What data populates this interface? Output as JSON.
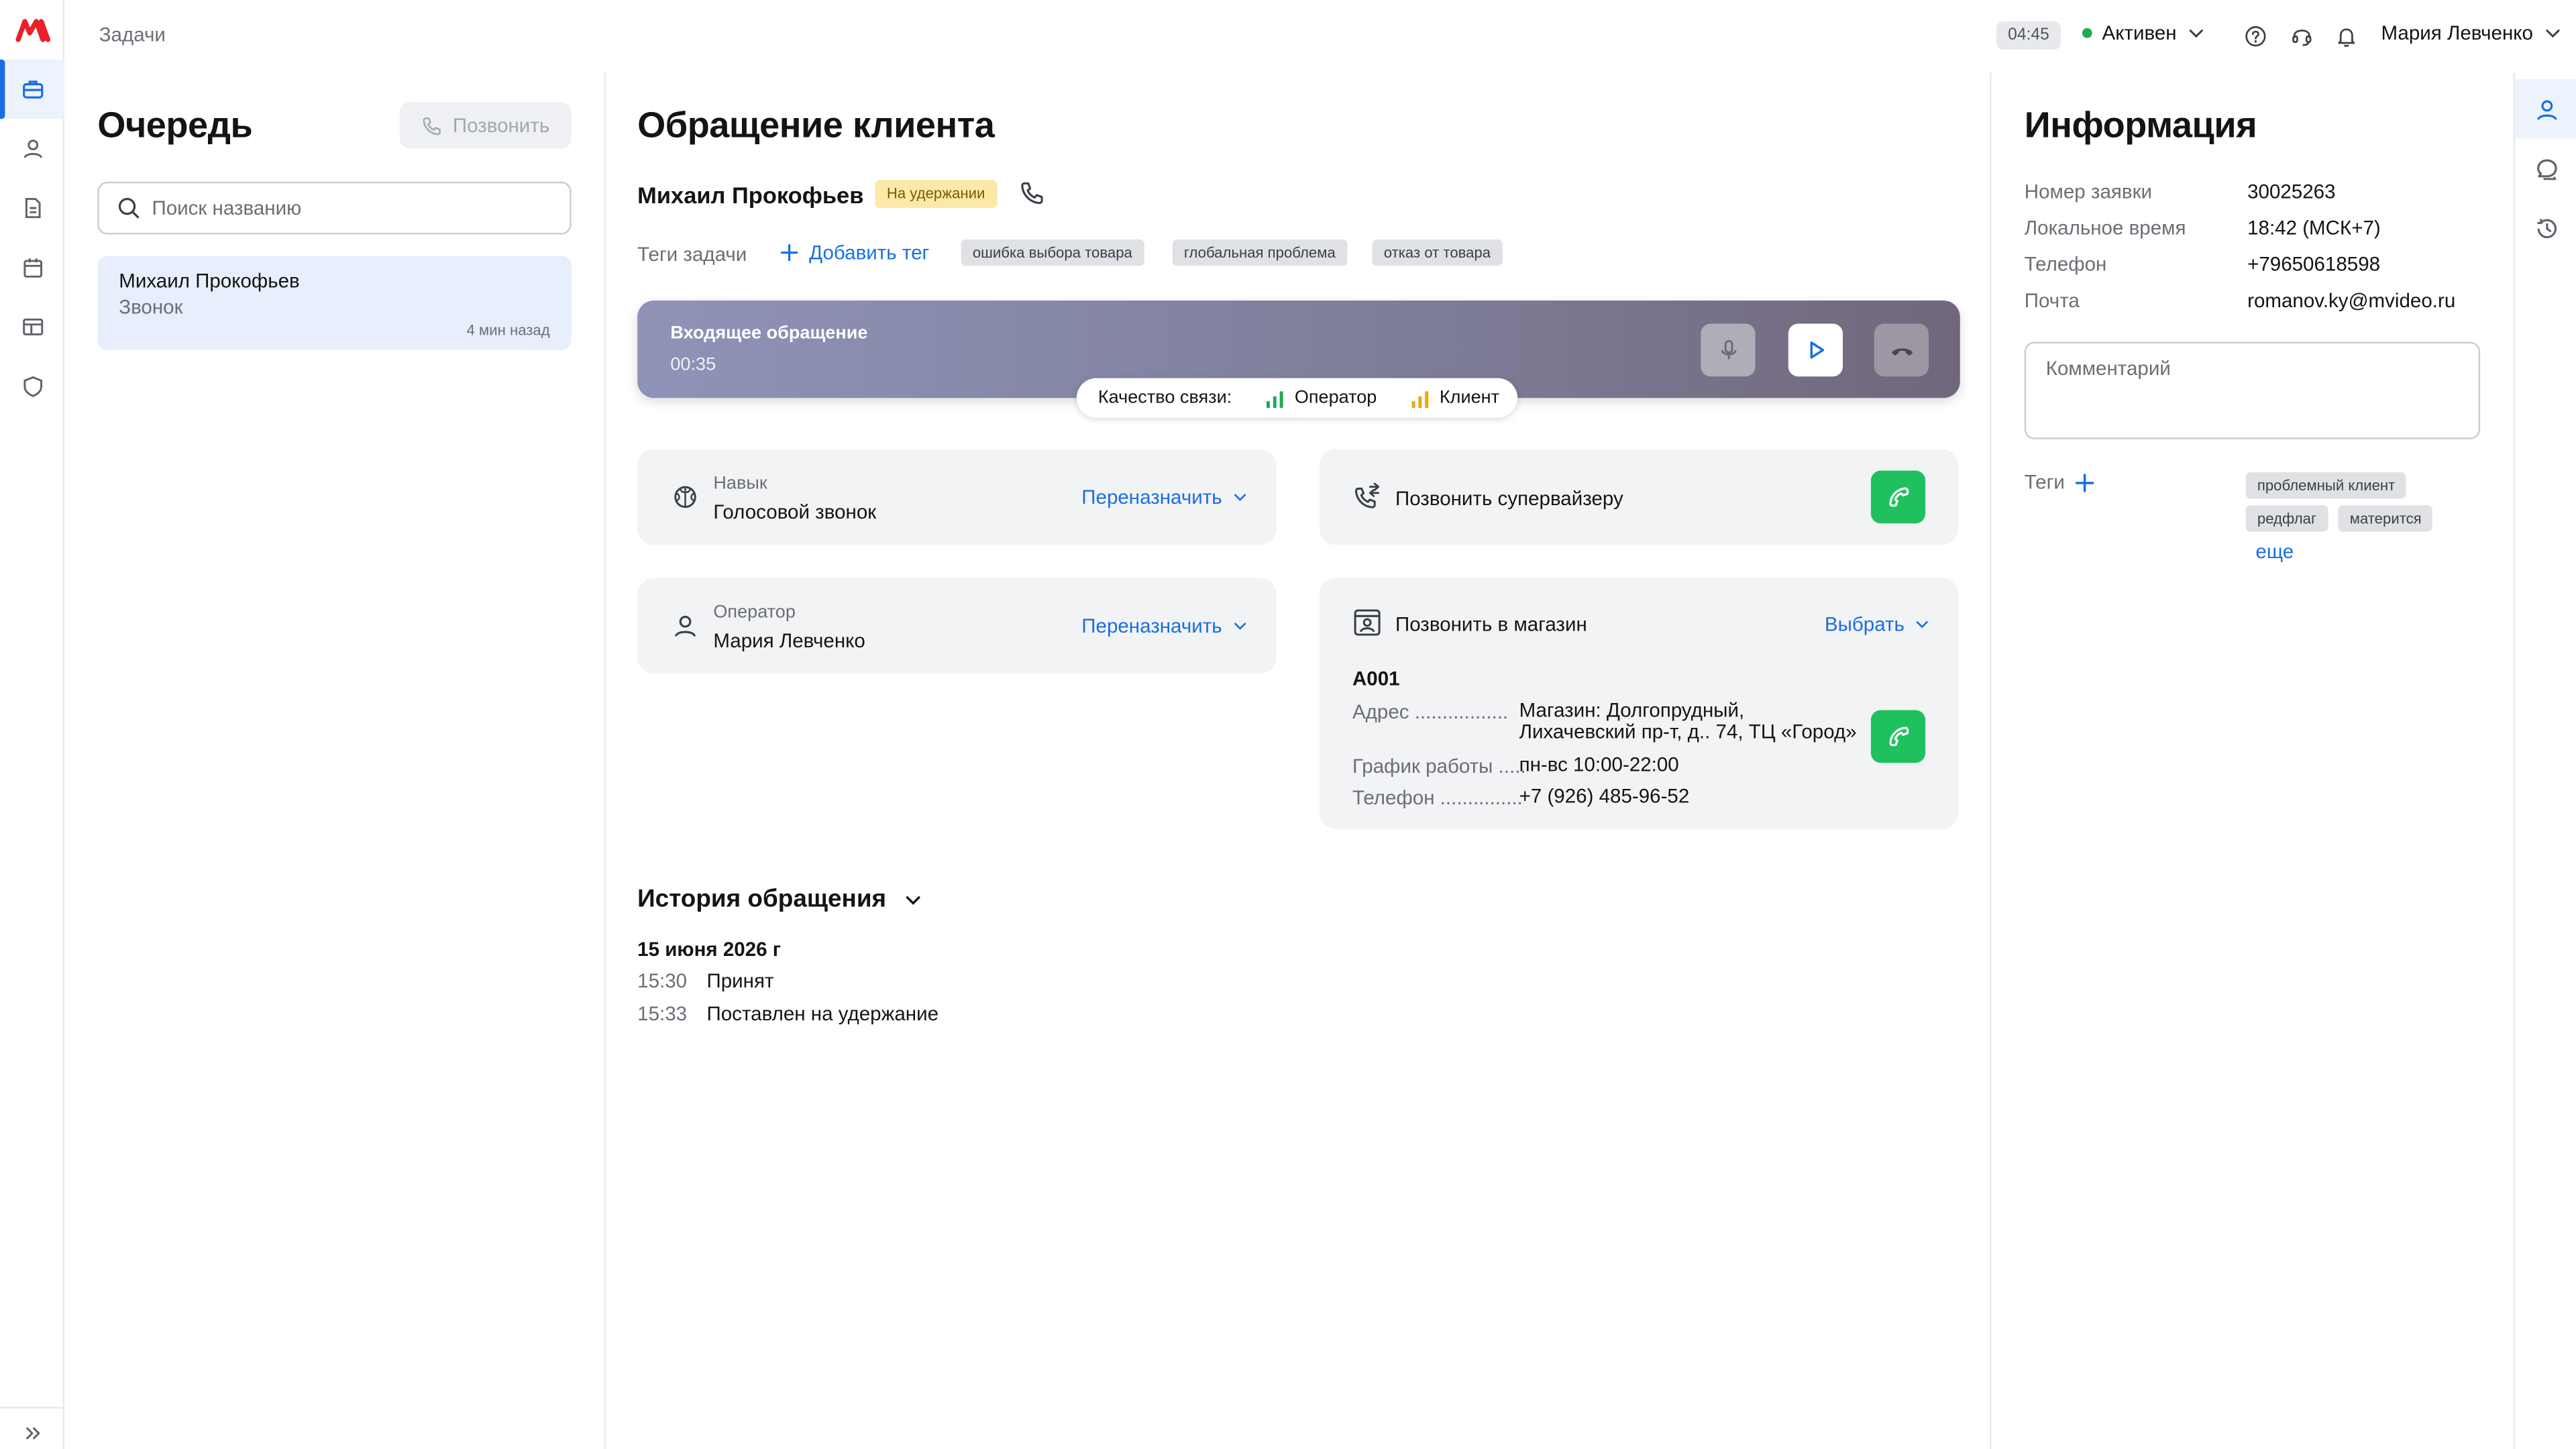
{
  "brand": {
    "logo_text": "M",
    "accent": "#1a6fe0",
    "logo_color": "#e8212b"
  },
  "sidebar": {
    "items": [
      {
        "icon": "briefcase-icon",
        "active": true
      },
      {
        "icon": "user-icon",
        "active": false
      },
      {
        "icon": "document-icon",
        "active": false
      },
      {
        "icon": "calendar-icon",
        "active": false
      },
      {
        "icon": "table-icon",
        "active": false
      },
      {
        "icon": "shield-icon",
        "active": false
      }
    ],
    "expand_icon": "chevrons-right-icon"
  },
  "topbar": {
    "breadcrumb": "Задачи",
    "timer": "04:45",
    "status": "Активен",
    "status_color": "#1faa55",
    "icons": [
      "help-icon",
      "headset-icon",
      "bell-icon"
    ],
    "user_name": "Мария Левченко"
  },
  "queue": {
    "title": "Очередь",
    "call_button": "Позвонить",
    "search_placeholder": "Поиск названию",
    "items": [
      {
        "name": "Михаил Прокофьев",
        "type": "Звонок",
        "time": "4 мин назад"
      }
    ]
  },
  "request": {
    "title": "Обращение клиента",
    "client_name": "Михаил Прокофьев",
    "status_badge": "На удержании",
    "tags_label": "Теги задачи",
    "add_tag": "Добавить тег",
    "tags": [
      "ошибка выбора товара",
      "глобальная проблема",
      "отказ от товара"
    ],
    "call": {
      "title": "Входящее обращение",
      "duration": "00:35",
      "quality_label": "Качество связи:",
      "operator": "Оператор",
      "client": "Клиент",
      "operator_signal_color": "#1faa55",
      "client_signal_color": "#f0a500"
    },
    "skill": {
      "label": "Навык",
      "value": "Голосовой звонок",
      "action": "Переназначить"
    },
    "operator": {
      "label": "Оператор",
      "value": "Мария Левченко",
      "action": "Переназначить"
    },
    "supervisor": {
      "label": "Позвонить супервайзеру"
    },
    "store": {
      "label": "Позвонить в магазин",
      "action": "Выбрать",
      "code": "A001",
      "address_key": "Адрес",
      "address_line1": "Магазин: Долгопрудный,",
      "address_line2": "Лихачевский пр-т, д.. 74, ТЦ «Город»",
      "hours_key": "График работы",
      "hours": "пн-вс 10:00-22:00",
      "phone_key": "Телефон",
      "phone": "+7 (926) 485-96-52"
    },
    "history": {
      "title": "История обращения",
      "date": "15 июня 2026 г",
      "events": [
        {
          "time": "15:30",
          "text": "Принят"
        },
        {
          "time": "15:33",
          "text": "Поставлен на удержание"
        }
      ]
    }
  },
  "info": {
    "title": "Информация",
    "rows": [
      {
        "key": "Номер заявки",
        "value": "30025263"
      },
      {
        "key": "Локальное время",
        "value": "18:42 (МСК+7)"
      },
      {
        "key": "Телефон",
        "value": "+79650618598"
      },
      {
        "key": "Почта",
        "value": "romanov.ky@mvideo.ru"
      }
    ],
    "comment_placeholder": "Комментарий",
    "tags_label": "Теги",
    "tags": [
      "проблемный клиент",
      "редфлаг",
      "матерится"
    ],
    "more": "еще"
  },
  "right_rail": {
    "icons": [
      "profile-icon",
      "chat-icon",
      "history-icon"
    ]
  }
}
